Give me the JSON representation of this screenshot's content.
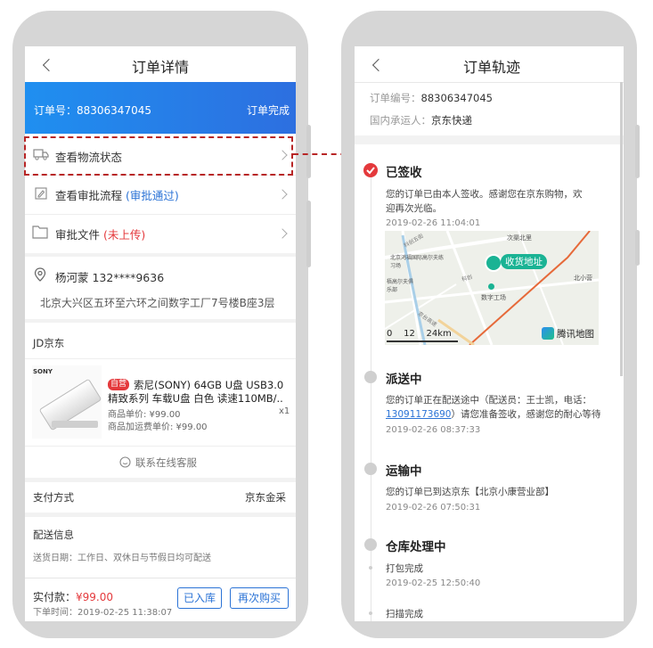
{
  "left": {
    "nav_title": "订单详情",
    "order_banner": {
      "label": "订单号：88306347045",
      "status": "订单完成"
    },
    "logistics": {
      "label": "查看物流状态"
    },
    "approval": {
      "label": "查看审批流程",
      "status": "(审批通过)"
    },
    "files": {
      "label": "审批文件",
      "status": "(未上传)"
    },
    "address": {
      "name_phone": "杨河蒙  132****9636",
      "detail": "北京大兴区五环至六环之间数字工厂7号楼B座3层"
    },
    "shop": "JD京东",
    "product": {
      "brand_text": "SONY",
      "tag": "自营",
      "title_line1": "索尼(SONY) 64GB U盘 USB3.0",
      "title_line2": "精致系列 车载U盘 白色 读速110MB/...",
      "unit_price": "商品单价: ¥99.00",
      "qty": "x1",
      "extra_price": "商品加运费单价: ¥99.00"
    },
    "service": "联系在线客服",
    "payment": {
      "label": "支付方式",
      "value": "京东金采"
    },
    "delivery": {
      "title": "配送信息",
      "date": "送货日期：工作日、双休日与节假日均可配送"
    },
    "footer": {
      "paid_label": "实付款：",
      "paid_value": "¥99.00",
      "order_time": "下单时间：2019-02-25 11:38:07",
      "btn_stock": "已入库",
      "btn_rebuy": "再次购买"
    }
  },
  "right": {
    "nav_title": "订单轨迹",
    "order_no_label": "订单编号：",
    "order_no": "88306347045",
    "carrier_label": "国内承运人：",
    "carrier": "京东快递",
    "timeline": [
      {
        "title": "已签收",
        "desc1": "您的订单已由本人签收。感谢您在京东购物，欢",
        "desc2": "迎再次光临。",
        "time": "2019-02-26 11:04:01"
      },
      {
        "title": "派送中",
        "desc1": "您的订单正在配送途中（配送员：王士凯，电话：",
        "phone": "13091173690",
        "desc2": "）请您准备签收，感谢您的耐心等待",
        "time": "2019-02-26 08:37:33"
      },
      {
        "title": "运输中",
        "desc1": "您的订单已到达京东【北京小康营业部】",
        "time": "2019-02-26 07:50:31"
      },
      {
        "title": "仓库处理中",
        "sub": [
          {
            "text": "打包完成",
            "time": "2019-02-25 12:50:40"
          },
          {
            "text": "扫描完成"
          }
        ]
      }
    ],
    "map": {
      "pin_label": "收货地址",
      "brand": "腾讯地图",
      "scale": "0    12    24km",
      "labels": [
        "次渠北里",
        "北京鸿福国际高尔夫练习场",
        "梧高尔夫俱乐部",
        "数字工场",
        "北小营",
        "科创五街",
        "科创",
        "京台高速"
      ]
    }
  },
  "colors": {
    "accent_blue": "#2b73d6",
    "banner_blue": "#1a7ee8",
    "check_red": "#e4393c",
    "highlight": "#b82626"
  }
}
